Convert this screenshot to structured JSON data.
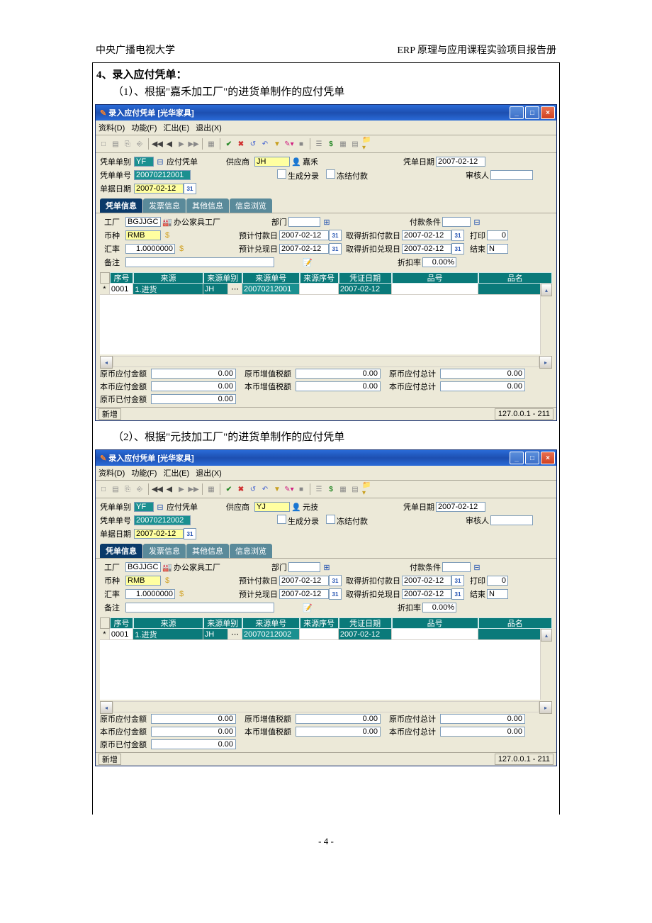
{
  "pageHeader": {
    "left": "中央广播电视大学",
    "right": "ERP 原理与应用课程实验项目报告册"
  },
  "section": "4、录入应付凭单：",
  "sub1": "（1）、根据\"嘉禾加工厂\"的进货单制作的应付凭单",
  "sub2": "（2）、根据\"元技加工厂\"的进货单制作的应付凭单",
  "pageNum": "- 4 -",
  "win": {
    "title": "录入应付凭单 [光华家具]",
    "menu": {
      "d": "资料(D)",
      "f": "功能(F)",
      "e": "汇出(E)",
      "x": "退出(X)"
    }
  },
  "labels": {
    "voucherType": "凭单单别",
    "voucherTypeName": "应付凭单",
    "supplier": "供应商",
    "voucherDate": "凭单日期",
    "voucherNo": "凭单单号",
    "genEntry": "生成分录",
    "freezePay": "冻结付款",
    "auditor": "审核人",
    "billDate": "单据日期",
    "tab1": "凭单信息",
    "tab2": "发票信息",
    "tab3": "其他信息",
    "tab4": "信息浏览",
    "factory": "工厂",
    "factoryName": "办公家具工厂",
    "dept": "部门",
    "payTerm": "付款条件",
    "currency": "币种",
    "expectPay": "预计付款日",
    "discountPay": "取得折扣付款日",
    "print": "打印",
    "rate": "汇率",
    "expectCash": "预计兑现日",
    "discountCash": "取得折扣兑现日",
    "end": "结束",
    "remark": "备注",
    "discountRate": "折扣率",
    "gh": {
      "seq": "序号",
      "src": "来源",
      "srcType": "来源单别",
      "srcNo": "来源单号",
      "srcSeq": "来源序号",
      "vdate": "凭证日期",
      "itemNo": "品号",
      "itemName": "品名"
    },
    "t": {
      "origPay": "原币应付金额",
      "origTax": "原币增值税额",
      "origTotal": "原币应付总计",
      "locPay": "本币应付金额",
      "locTax": "本币增值税额",
      "locTotal": "本币应付总计",
      "paid": "原币已付金额"
    },
    "status": "新增"
  },
  "s1": {
    "vtype": "YF",
    "supCode": "JH",
    "supName": "嘉禾",
    "vdate": "2007-02-12",
    "vno": "20070212001",
    "bdate": "2007-02-12",
    "factory": "BGJJGC",
    "cur": "RMB",
    "rate": "1.0000000",
    "d1": "2007-02-12",
    "d2": "2007-02-12",
    "d3": "2007-02-12",
    "d4": "2007-02-12",
    "print": "0",
    "end": "N",
    "disc": "0.00%",
    "row": {
      "seq": "0001",
      "src": "1.进货",
      "stype": "JH",
      "sno": "20070212001",
      "vd": "2007-02-12"
    },
    "totals": {
      "a": "0.00",
      "b": "0.00",
      "c": "0.00",
      "d": "0.00",
      "e": "0.00",
      "f": "0.00",
      "g": "0.00"
    },
    "ip": "127.0.0.1 - 211"
  },
  "s2": {
    "vtype": "YF",
    "supCode": "YJ",
    "supName": "元技",
    "vdate": "2007-02-12",
    "vno": "20070212002",
    "bdate": "2007-02-12",
    "factory": "BGJJGC",
    "cur": "RMB",
    "rate": "1.0000000",
    "d1": "2007-02-12",
    "d2": "2007-02-12",
    "d3": "2007-02-12",
    "d4": "2007-02-12",
    "print": "0",
    "end": "N",
    "disc": "0.00%",
    "row": {
      "seq": "0001",
      "src": "1.进货",
      "stype": "JH",
      "sno": "20070212002",
      "vd": "2007-02-12"
    },
    "totals": {
      "a": "0.00",
      "b": "0.00",
      "c": "0.00",
      "d": "0.00",
      "e": "0.00",
      "f": "0.00",
      "g": "0.00"
    },
    "ip": "127.0.0.1 - 211"
  }
}
